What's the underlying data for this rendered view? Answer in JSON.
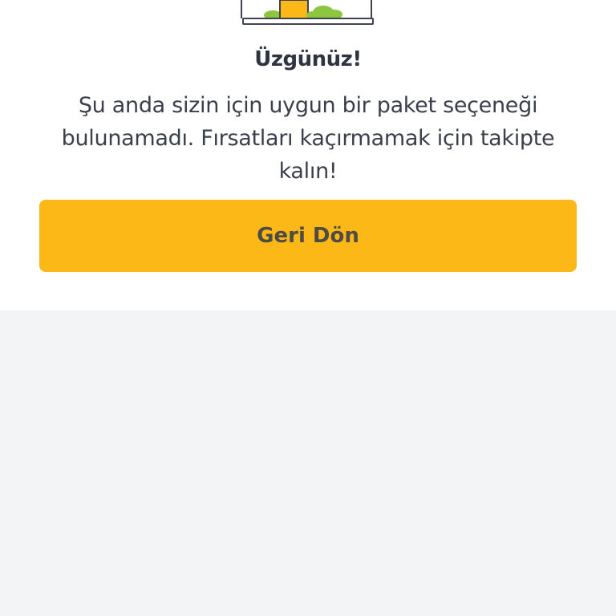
{
  "illustration": {
    "icon": "sad-empty-package-illustration",
    "colors": {
      "outline": "#3f4451",
      "jar": "#fbb817",
      "bushes": "#8cc63f"
    }
  },
  "empty_state": {
    "title": "Üzgünüz!",
    "message": "Şu anda sizin için uygun bir paket seçeneği bulunamadı. Fırsatları kaçırmamak için takipte kalın!"
  },
  "actions": {
    "back_label": "Geri Dön"
  },
  "colors": {
    "accent": "#fbb817",
    "background": "#f3f4f6",
    "card": "#ffffff",
    "title_text": "#2f3441",
    "body_text": "#3a3f4b"
  }
}
